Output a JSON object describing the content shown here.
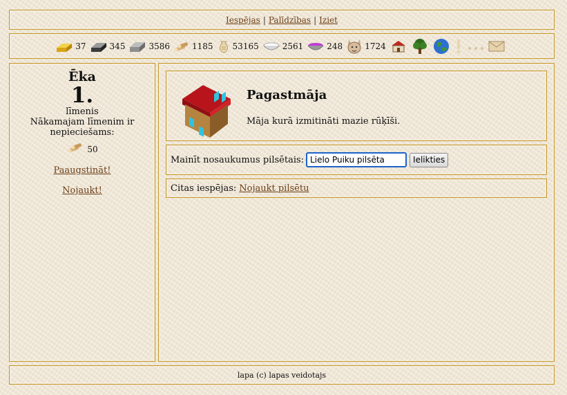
{
  "nav": {
    "options": "Iespējas",
    "sep1": "|",
    "help": "Palīdzības",
    "sep2": "|",
    "exit": "Iziet"
  },
  "resources": [
    {
      "icon": "gold-bar-icon",
      "value": "37"
    },
    {
      "icon": "iron-bar-icon",
      "value": "345"
    },
    {
      "icon": "stone-block-icon",
      "value": "3586"
    },
    {
      "icon": "wood-logs-icon",
      "value": "1185"
    },
    {
      "icon": "grain-sack-icon",
      "value": "53165"
    },
    {
      "icon": "salt-bowl-icon",
      "value": "2561"
    },
    {
      "icon": "berries-bowl-icon",
      "value": "248"
    },
    {
      "icon": "population-face-icon",
      "value": "1724"
    }
  ],
  "quick_icons": [
    "house-icon",
    "tree-icon",
    "globe-icon",
    "exclamation-icon",
    "dots-icon",
    "envelope-icon"
  ],
  "left": {
    "building_name": "Ēka",
    "level": "1.",
    "level_label": "līmenis",
    "req_text": "Nākamajam līmenim ir nepieciešams:",
    "req_icon": "wood-logs-icon",
    "req_value": "50",
    "upgrade_link": "Paaugstināt!",
    "demolish_link": "Nojaukt!"
  },
  "main": {
    "title": "Pagastmāja",
    "description": "Māja kurā izmitināti mazie rūķīši.",
    "rename_label": "Mainīt nosaukumus pilsētais:",
    "rename_value": "Lielo Puiku pilsēta",
    "submit_label": "Ielikties",
    "options_label": "Citas iespējas:",
    "options_link": "Nojaukt pilsētu"
  },
  "footer": {
    "text": "lapa (c) lapas veidotajs"
  },
  "colors": {
    "link": "#6b3f17",
    "frame_border": "#c79a2a",
    "background": "#efe6d6",
    "input_focus": "#1c63c9"
  }
}
